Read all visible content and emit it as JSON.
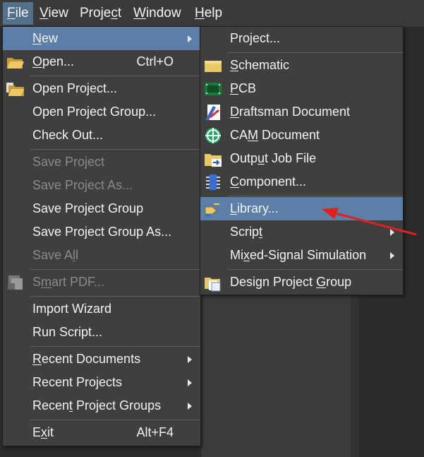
{
  "menubar": [
    {
      "label": "File",
      "accel": "F",
      "active": true
    },
    {
      "label": "View",
      "accel": "V"
    },
    {
      "label": "Project",
      "accel": "c"
    },
    {
      "label": "Window",
      "accel": "W"
    },
    {
      "label": "Help",
      "accel": "H"
    }
  ],
  "file_menu": [
    {
      "label": "New",
      "shortcut": "",
      "submenu": true,
      "highlight": true,
      "accel": "N"
    },
    {
      "label": "Open...",
      "shortcut": "Ctrl+O",
      "icon": "open-folder-icon",
      "accel": "O"
    },
    {
      "sep": true
    },
    {
      "label": "Open Project...",
      "icon": "open-project-icon"
    },
    {
      "label": "Open Project Group..."
    },
    {
      "label": "Check Out..."
    },
    {
      "sep": true
    },
    {
      "label": "Save Project",
      "disabled": true
    },
    {
      "label": "Save Project As...",
      "disabled": true
    },
    {
      "label": "Save Project Group"
    },
    {
      "label": "Save Project Group As..."
    },
    {
      "label": "Save All",
      "disabled": true
    },
    {
      "sep": true
    },
    {
      "label": "Smart PDF...",
      "disabled": true,
      "icon": "smart-pdf-icon"
    },
    {
      "sep": true
    },
    {
      "label": "Import Wizard"
    },
    {
      "label": "Run Script..."
    },
    {
      "sep": true
    },
    {
      "label": "Recent Documents",
      "submenu": true
    },
    {
      "label": "Recent Projects",
      "submenu": true
    },
    {
      "label": "Recent Project Groups",
      "submenu": true
    },
    {
      "sep": true
    },
    {
      "label": "Exit",
      "shortcut": "Alt+F4"
    }
  ],
  "new_submenu": [
    {
      "label": "Project..."
    },
    {
      "sep": true
    },
    {
      "label": "Schematic",
      "icon": "schematic-icon"
    },
    {
      "label": "PCB",
      "icon": "pcb-icon"
    },
    {
      "label": "Draftsman Document",
      "icon": "draftsman-icon"
    },
    {
      "label": "CAM Document",
      "icon": "cam-icon"
    },
    {
      "label": "Output Job File",
      "icon": "output-job-icon"
    },
    {
      "label": "Component...",
      "icon": "component-icon"
    },
    {
      "sep": true
    },
    {
      "label": "Library...",
      "icon": "library-icon",
      "highlight": true
    },
    {
      "label": "Script",
      "submenu": true
    },
    {
      "label": "Mixed-Signal Simulation",
      "submenu": true
    },
    {
      "sep": true
    },
    {
      "label": "Design Project Group",
      "icon": "project-group-icon"
    }
  ],
  "colors": {
    "highlight": "#5b7fa6",
    "menubar_active": "#53708c",
    "annotation_arrow": "#e02020"
  }
}
